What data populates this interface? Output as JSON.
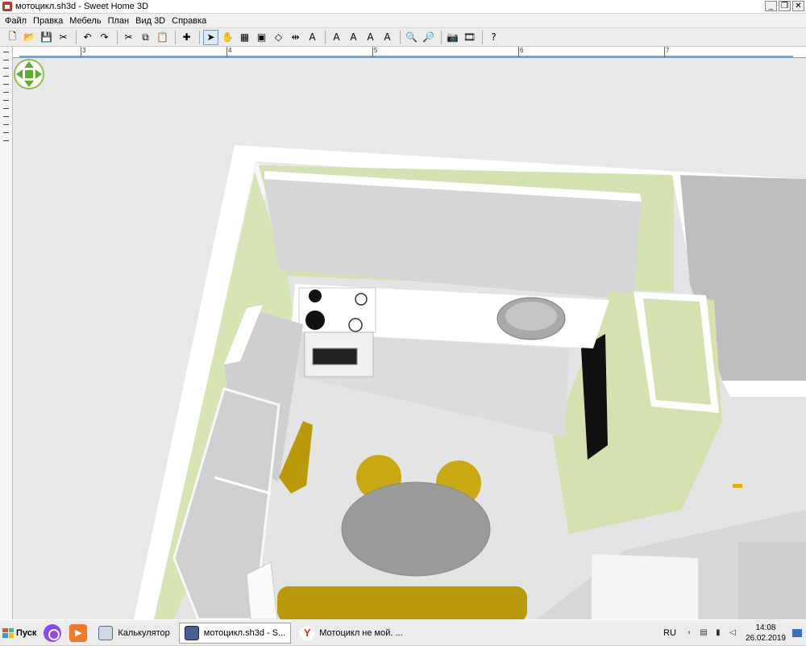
{
  "window": {
    "title": "мотоцикл.sh3d - Sweet Home 3D",
    "minimize_glyph": "_",
    "maximize_glyph": "❐",
    "close_glyph": "✕"
  },
  "menu": [
    "Файл",
    "Правка",
    "Мебель",
    "План",
    "Вид 3D",
    "Справка"
  ],
  "toolbar": {
    "icons": [
      "new-icon",
      "open-icon",
      "save-icon",
      "cut-preferences-icon",
      "undo-icon",
      "redo-icon",
      "cut-icon",
      "copy-icon",
      "paste-icon",
      "add-furniture-icon",
      "select-icon",
      "pan-icon",
      "create-walls-icon",
      "create-rooms-icon",
      "create-polylines-icon",
      "create-dimensions-icon",
      "add-text-icon",
      "text-style-up-icon",
      "text-style-down-icon",
      "text-bold-icon",
      "text-italic-icon",
      "zoom-in-icon",
      "zoom-out-icon",
      "create-photo-icon",
      "create-video-icon",
      "help-icon"
    ],
    "glyphs": [
      "🗋",
      "📂",
      "💾",
      "✂",
      "↶",
      "↷",
      "✂",
      "⧉",
      "📋",
      "✚",
      "➤",
      "✋",
      "▦",
      "▣",
      "◇",
      "⇹",
      "A",
      "A",
      "A",
      "A",
      "A",
      "🔍",
      "🔎",
      "📷",
      "🎞",
      "?"
    ]
  },
  "ruler": {
    "labels": [
      "3",
      "4",
      "5",
      "6",
      "7"
    ]
  },
  "scene": {
    "description_icon": "3d-navigation-arrows-icon",
    "colors": {
      "background": "#e8e8e8",
      "wall_top": "#ffffff",
      "wall_green": "#d4e1b0",
      "cabinet": "#d8d8d8",
      "floor": "#e2e2e2",
      "chair_yellow": "#c9a912",
      "table": "#9a9a9a",
      "sofa_yellow": "#b99b0a"
    }
  },
  "taskbar": {
    "start_label": "Пуск",
    "items": [
      {
        "label": "Калькулятор",
        "icon": "calculator-icon",
        "active": false
      },
      {
        "label": "мотоцикл.sh3d - S...",
        "icon": "sweet-home-3d-icon",
        "active": true
      },
      {
        "label": "Мотоцикл не мой. ...",
        "icon": "yandex-browser-icon",
        "active": false
      }
    ],
    "yandex_letter": "Y",
    "player_glyph": "▶",
    "tray": {
      "language": "RU",
      "time": "14:08",
      "date": "26.02.2019"
    }
  }
}
